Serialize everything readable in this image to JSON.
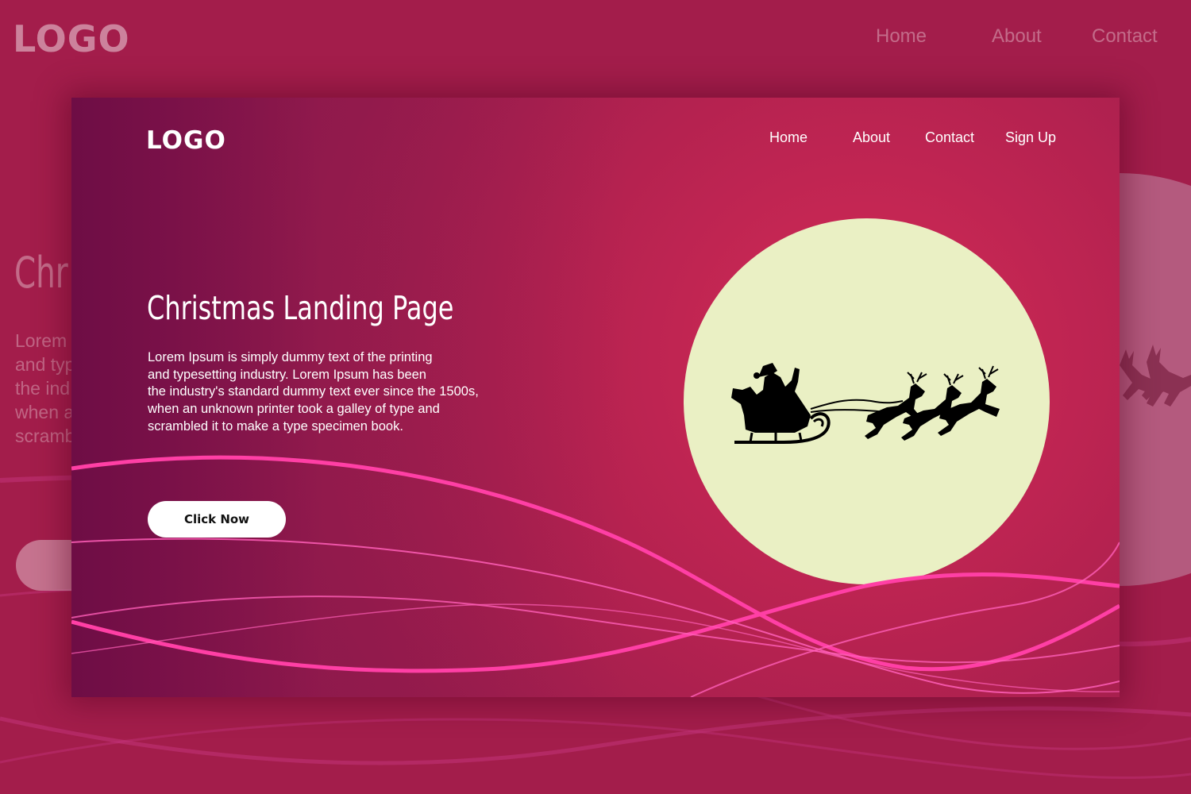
{
  "background": {
    "logo": "LOGO",
    "nav": [
      "Home",
      "About",
      "Contact"
    ],
    "title_fragment": "Chr",
    "text_fragment": "Lorem\nand typ\nthe ind\nwhen a\nscramb"
  },
  "card": {
    "logo": "LOGO",
    "nav": {
      "home": "Home",
      "about": "About",
      "contact": "Contact",
      "signup": "Sign Up"
    },
    "hero": {
      "title": "Christmas Landing Page",
      "text": "Lorem Ipsum is simply dummy text of the printing\nand typesetting industry. Lorem Ipsum has been\nthe industry's standard dummy text ever since the 1500s,\nwhen an unknown printer took a galley of type and\nscrambled it to make a type specimen book.",
      "button_label": "Click Now"
    }
  },
  "icons": {
    "illustration": "santa-sleigh-reindeer-icon"
  },
  "colors": {
    "page_background": "#a31d4b",
    "card_glow": "#d32a56",
    "card_dark": "#6e0d45",
    "moon": "#eaf0c4",
    "wave_accent": "#ff3fa5",
    "button": "#ffffff",
    "silhouette": "#000000"
  }
}
